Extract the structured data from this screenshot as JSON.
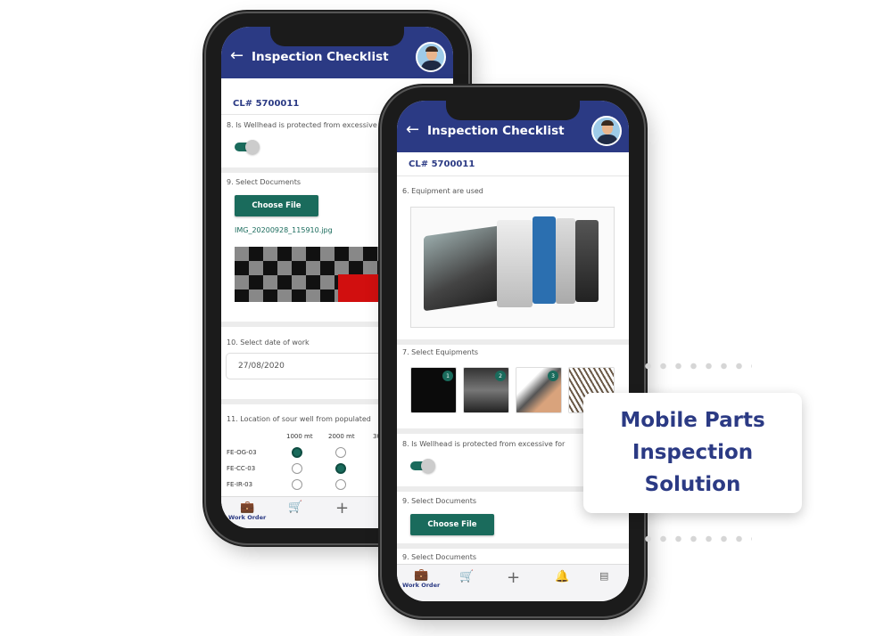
{
  "back_phone": {
    "header": {
      "title": "Inspection Checklist",
      "back_icon": "arrow-left-icon"
    },
    "checklist_id": "CL# 5700011",
    "q8": {
      "label": "8. Is Wellhead is protected from excessive",
      "toggle_on": true
    },
    "q9": {
      "label": "9. Select Documents",
      "button": "Choose File",
      "filename": "IMG_20200928_115910.jpg"
    },
    "q10": {
      "label": "10. Select date of work",
      "value": "27/08/2020"
    },
    "q11": {
      "label": "11. Location of sour well from populated",
      "columns": [
        "1000 mt",
        "2000 mt",
        "30"
      ],
      "rows": [
        {
          "name": "FE-OG-03",
          "selected": 0
        },
        {
          "name": "FE-CC-03",
          "selected": 1
        },
        {
          "name": "FE-IR-03",
          "selected": null
        }
      ]
    },
    "nav": {
      "work_order": "Work Order"
    }
  },
  "front_phone": {
    "header": {
      "title": "Inspection Checklist",
      "back_icon": "arrow-left-icon"
    },
    "checklist_id": "CL# 5700011",
    "q6": {
      "label": "6. Equipment are used"
    },
    "q7": {
      "label": "7. Select Equipments",
      "badges": [
        "1",
        "2",
        "3"
      ]
    },
    "q8": {
      "label": "8. Is Wellhead is protected from excessive for",
      "toggle_on": true
    },
    "q9": {
      "label": "9. Select Documents",
      "button": "Choose File"
    },
    "q9b": {
      "label": "9. Select Documents"
    },
    "nav": {
      "work_order": "Work Order"
    }
  },
  "card": {
    "line1": "Mobile Parts",
    "line2": "Inspection",
    "line3": "Solution"
  },
  "colors": {
    "header": "#2b3a84",
    "accent": "#1a6b5c"
  }
}
